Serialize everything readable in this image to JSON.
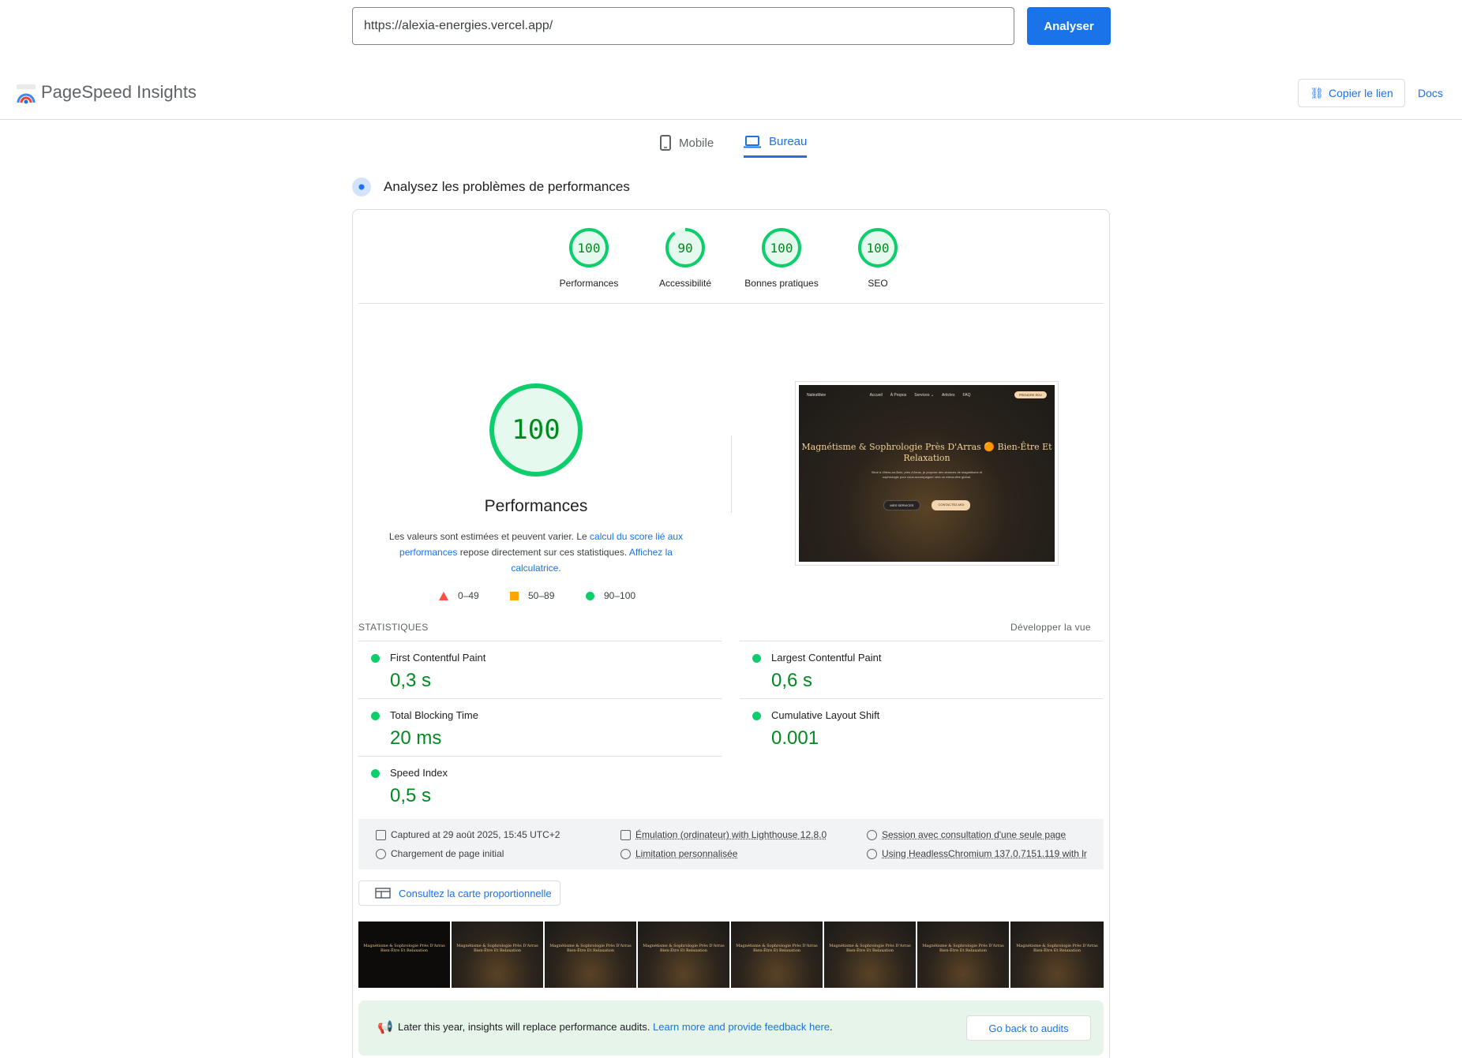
{
  "search": {
    "url": "https://alexia-energies.vercel.app/",
    "analyze_label": "Analyser"
  },
  "header": {
    "brand": "PageSpeed Insights",
    "copy_link": "Copier le lien",
    "docs": "Docs"
  },
  "tabs": {
    "mobile": "Mobile",
    "desktop": "Bureau"
  },
  "section_title": "Analysez les problèmes de performances",
  "scores": [
    {
      "label": "Performances",
      "value": "100",
      "fraction": 1.0
    },
    {
      "label": "Accessibilité",
      "value": "90",
      "fraction": 0.9
    },
    {
      "label": "Bonnes pratiques",
      "value": "100",
      "fraction": 1.0
    },
    {
      "label": "SEO",
      "value": "100",
      "fraction": 1.0
    }
  ],
  "main_score": {
    "value": "100",
    "title": "Performances"
  },
  "description": {
    "part1": "Les valeurs sont estimées et peuvent varier. Le ",
    "link1": "calcul du score lié aux performances",
    "part2": " repose directement sur ces statistiques. ",
    "link2": "Affichez la calculatrice",
    "part3": "."
  },
  "legend": {
    "low": "0–49",
    "mid": "50–89",
    "high": "90–100"
  },
  "colors": {
    "accent": "#1a73e8",
    "pass": "#0cce6b",
    "pass_text": "#008a1e",
    "average": "#ffa400",
    "fail": "#ff4e42"
  },
  "screenshot": {
    "brand": "NatiraMeie",
    "nav": [
      "Accueil",
      "À Propos",
      "Services ⌄",
      "Articles",
      "FAQ"
    ],
    "cta": "PRENDRE RDV",
    "heading": "Magnétisme & Sophrologie Près D'Arras 🟠 Bien-Être Et Relaxation",
    "paragraph": "Situé à Villers-au-Bois, près d'Arras, je propose des séances de magnétisme et sophrologie pour vous accompagner vers un mieux-être global.",
    "button1": "MES SERVICES",
    "button2": "CONTACTEZ-MOI"
  },
  "stats": {
    "heading": "STATISTIQUES",
    "expand": "Développer la vue",
    "metrics": [
      {
        "name": "First Contentful Paint",
        "value": "0,3 s"
      },
      {
        "name": "Largest Contentful Paint",
        "value": "0,6 s"
      },
      {
        "name": "Total Blocking Time",
        "value": "20 ms"
      },
      {
        "name": "Cumulative Layout Shift",
        "value": "0.001"
      },
      {
        "name": "Speed Index",
        "value": "0,5 s"
      }
    ]
  },
  "environment": {
    "captured": "Captured at 29 août 2025, 15:45 UTC+2",
    "load": "Chargement de page initial",
    "emulation": "Émulation (ordinateur) with Lighthouse 12.8.0",
    "throttling": "Limitation personnalisée",
    "session": "Session avec consultation d'une seule page",
    "browser": "Using HeadlessChromium 137.0.7151.119 with lr"
  },
  "treemap": "Consultez la carte proportionnelle",
  "filmstrip_caption": "Magnétisme & Sophrologie Près D'Arras Bien-Être Et Relaxation",
  "notice": {
    "text": "Later this year, insights will replace performance audits. ",
    "link": "Learn more and provide feedback here",
    "end": ".",
    "button": "Go back to audits"
  }
}
